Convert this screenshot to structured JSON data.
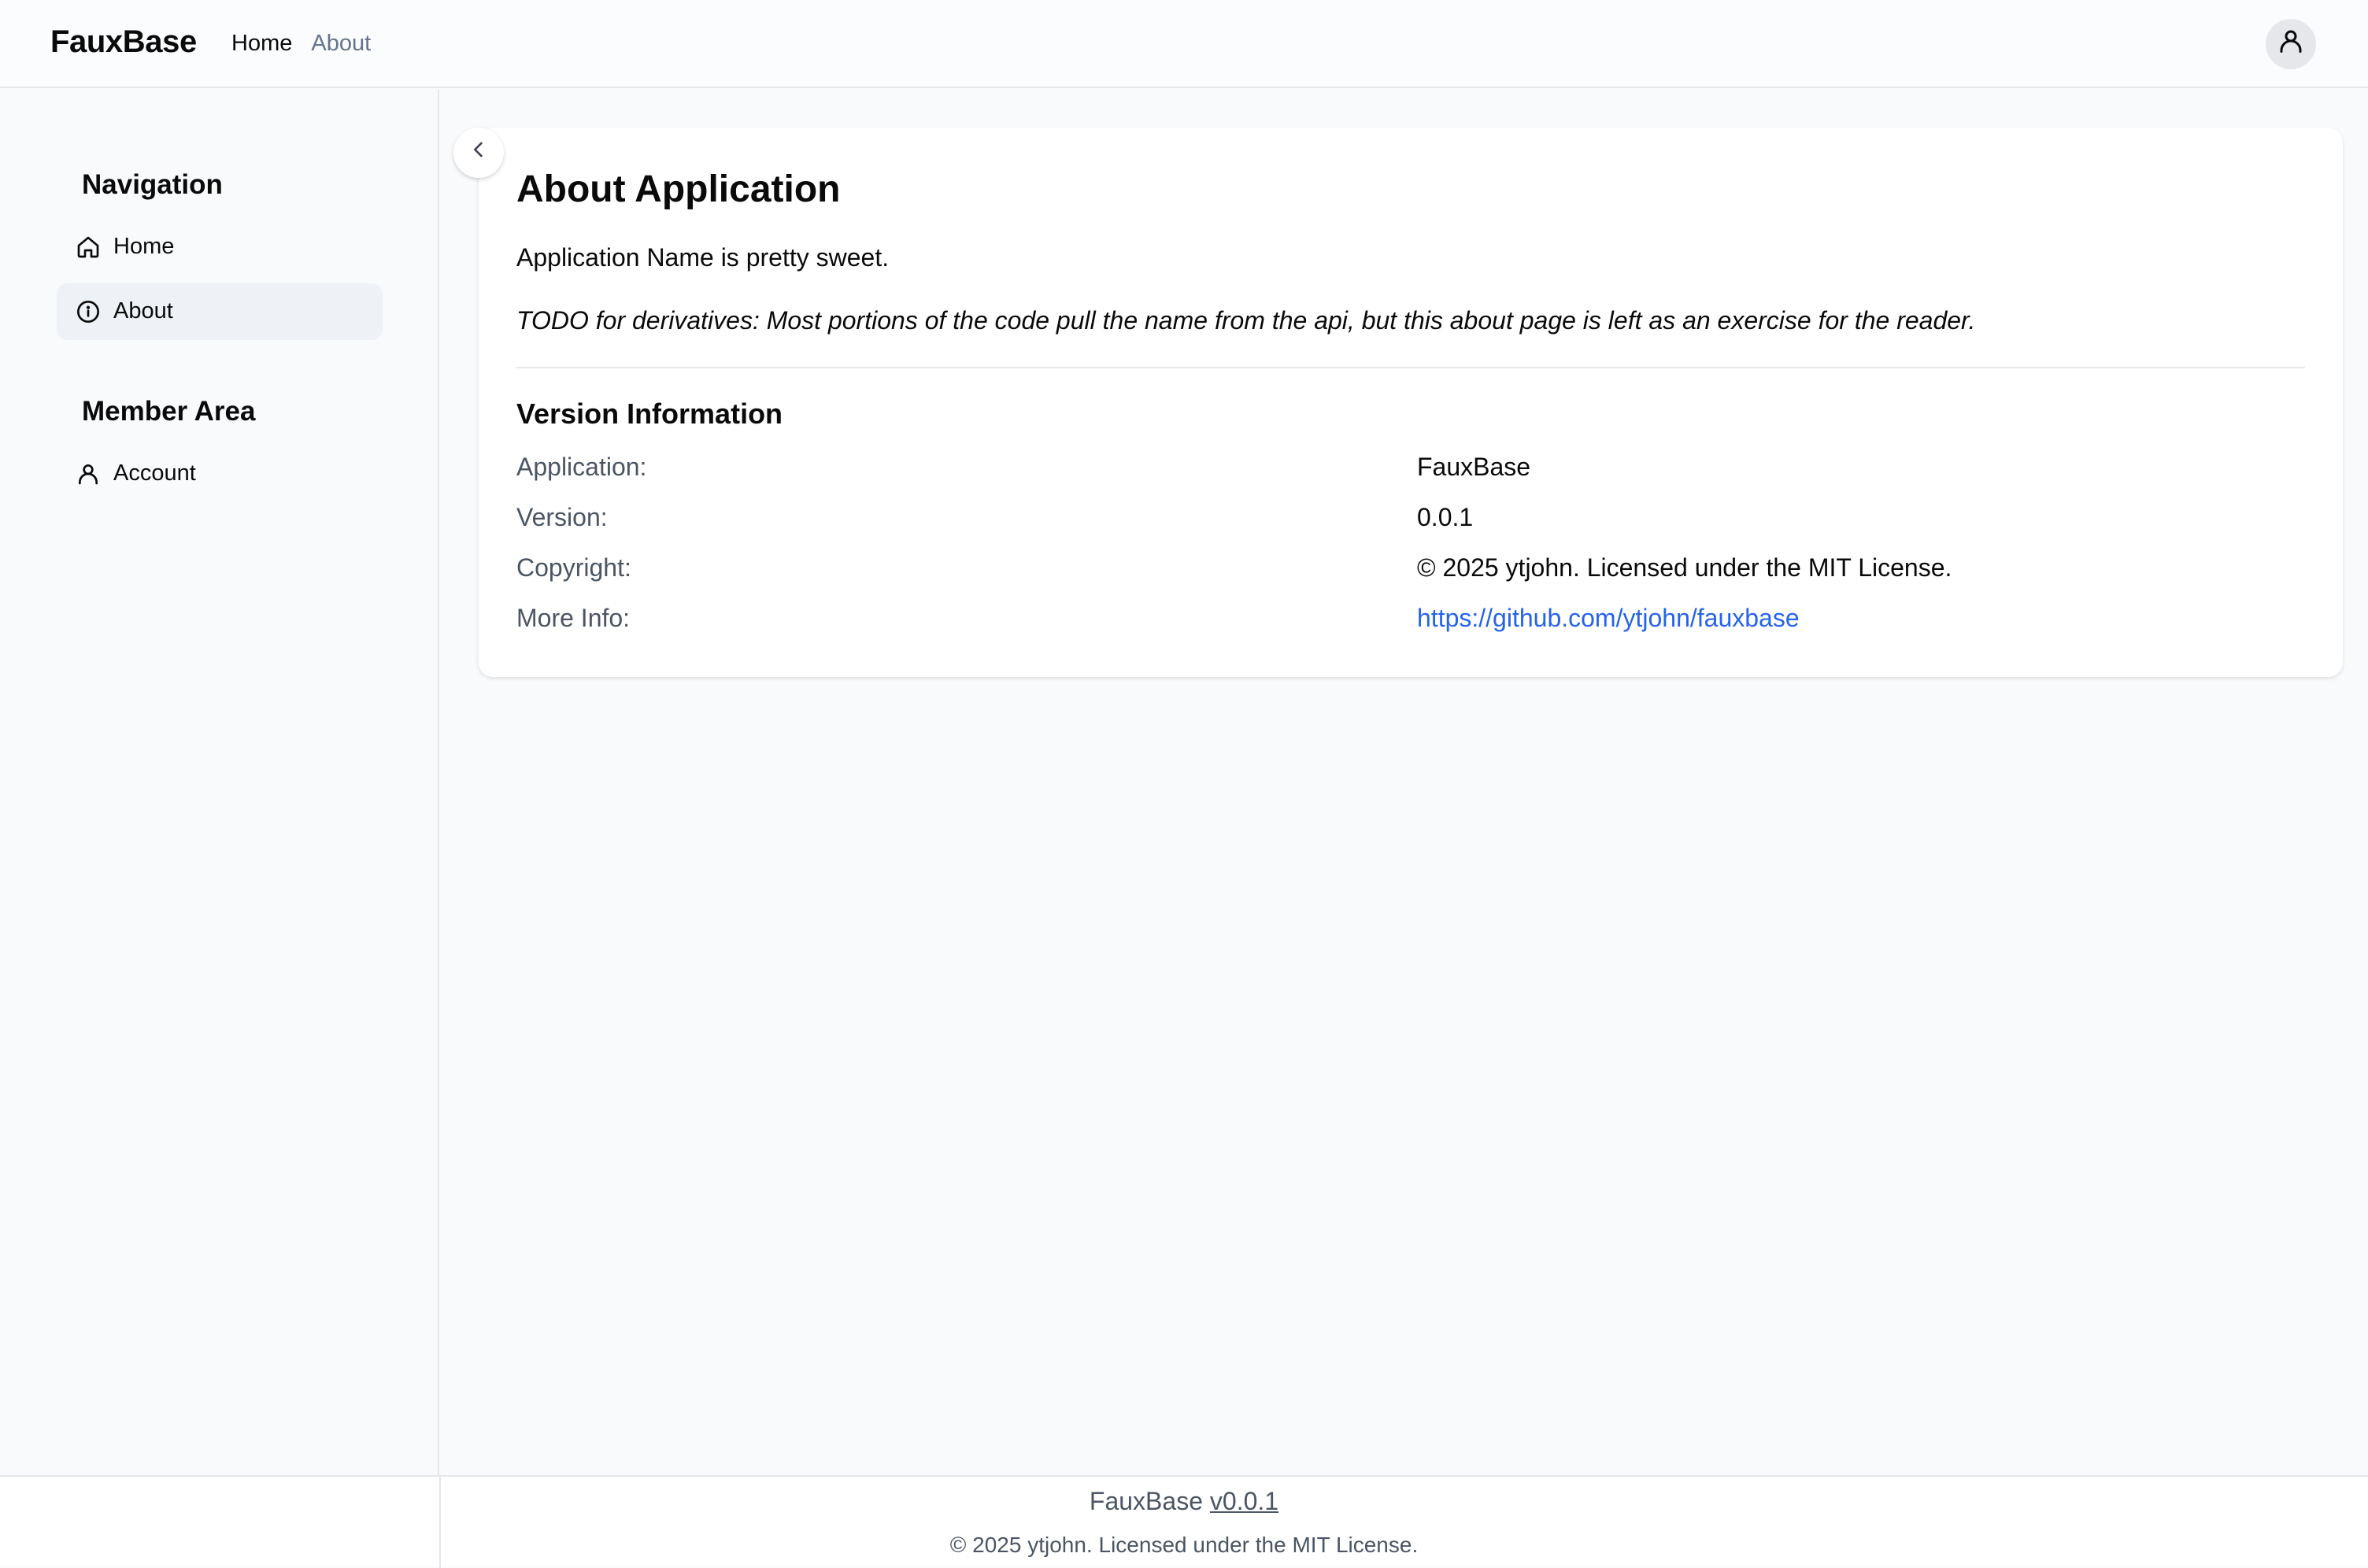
{
  "header": {
    "brand": "FauxBase",
    "nav": [
      {
        "label": "Home"
      },
      {
        "label": "About"
      }
    ],
    "avatar_icon": "user-icon"
  },
  "sidebar": {
    "sections": [
      {
        "title": "Navigation",
        "items": [
          {
            "label": "Home",
            "icon": "home-icon"
          },
          {
            "label": "About",
            "icon": "info-icon",
            "active": true
          }
        ]
      },
      {
        "title": "Member Area",
        "items": [
          {
            "label": "Account",
            "icon": "user-icon"
          }
        ]
      }
    ],
    "collapse_icon": "chevron-left-icon"
  },
  "main": {
    "title": "About Application",
    "lead": "Application Name is pretty sweet.",
    "todo": "TODO for derivatives: Most portions of the code pull the name from the api, but this about page is left as an exercise for the reader.",
    "version_heading": "Version Information",
    "info": [
      {
        "label": "Application:",
        "value": "FauxBase"
      },
      {
        "label": "Version:",
        "value": "0.0.1"
      },
      {
        "label": "Copyright:",
        "value": "© 2025 ytjohn. Licensed under the MIT License."
      },
      {
        "label": "More Info:",
        "value": "https://github.com/ytjohn/fauxbase"
      }
    ]
  },
  "footer": {
    "app_name": "FauxBase",
    "version_link": "v0.0.1",
    "copyright": "© 2025 ytjohn. Licensed under the MIT License."
  },
  "colors": {
    "link": "#2563eb",
    "active_bg": "#eef1f5",
    "muted_text": "#4b5563"
  }
}
